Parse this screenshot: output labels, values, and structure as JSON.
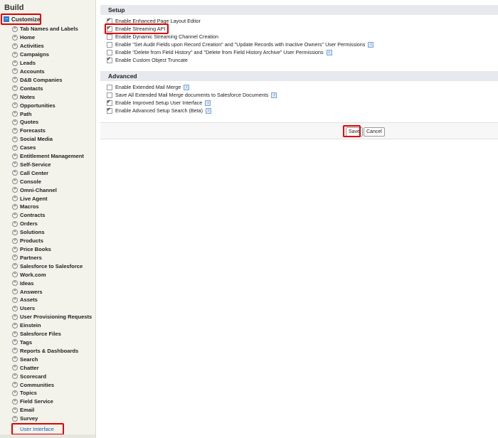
{
  "sidebar": {
    "title": "Build",
    "customize_label": "Customize",
    "items": [
      "Tab Names and Labels",
      "Home",
      "Activities",
      "Campaigns",
      "Leads",
      "Accounts",
      "D&B Companies",
      "Contacts",
      "Notes",
      "Opportunities",
      "Path",
      "Quotes",
      "Forecasts",
      "Social Media",
      "Cases",
      "Entitlement Management",
      "Self-Service",
      "Call Center",
      "Console",
      "Omni-Channel",
      "Live Agent",
      "Macros",
      "Contracts",
      "Orders",
      "Solutions",
      "Products",
      "Price Books",
      "Partners",
      "Salesforce to Salesforce",
      "Work.com",
      "Ideas",
      "Answers",
      "Assets",
      "Users",
      "User Provisioning Requests",
      "Einstein",
      "Salesforce Files",
      "Tags",
      "Reports & Dashboards",
      "Search",
      "Chatter",
      "Scorecard",
      "Communities",
      "Topics",
      "Field Service",
      "Email",
      "Survey"
    ],
    "selected_item": "User Interface"
  },
  "setup": {
    "header": "Setup",
    "options": [
      {
        "label": "Enable Enhanced Page Layout Editor",
        "checked": true,
        "info": false
      },
      {
        "label": "Enable Streaming API",
        "checked": true,
        "info": false
      },
      {
        "label": "Enable Dynamic Streaming Channel Creation",
        "checked": false,
        "info": false
      },
      {
        "label": "Enable \"Set Audit Fields upon Record Creation\" and \"Update Records with Inactive Owners\" User Permissions",
        "checked": false,
        "info": true
      },
      {
        "label": "Enable \"Delete from Field History\" and \"Delete from Field History Archive\" User Permissions",
        "checked": false,
        "info": true
      },
      {
        "label": "Enable Custom Object Truncate",
        "checked": true,
        "info": false
      }
    ]
  },
  "advanced": {
    "header": "Advanced",
    "options": [
      {
        "label": "Enable Extended Mail Merge",
        "checked": false,
        "info": true
      },
      {
        "label": "Save All Extended Mail Merge documents to Salesforce Documents",
        "checked": false,
        "info": true
      },
      {
        "label": "Enable Improved Setup User Interface",
        "checked": true,
        "info": true
      },
      {
        "label": "Enable Advanced Setup Search (Beta)",
        "checked": true,
        "info": true
      }
    ]
  },
  "buttons": {
    "save": "Save",
    "cancel": "Cancel"
  },
  "icons": {
    "info": "info-icon",
    "checkbox_checked": "checkmark-icon",
    "expand": "plus-icon",
    "collapse": "minus-icon"
  },
  "colors": {
    "highlight": "#e00000",
    "section_bg": "#e7e9ee",
    "sidebar_bg": "#f3f3ec",
    "link": "#1a5fb4"
  }
}
